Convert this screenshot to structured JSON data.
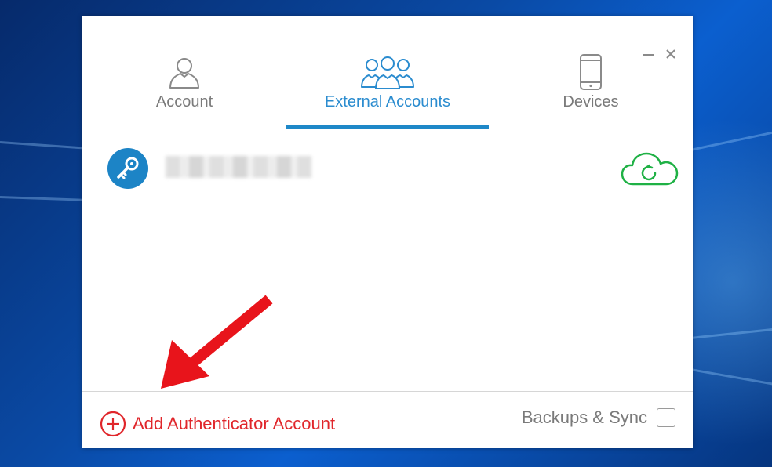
{
  "window": {
    "minimize_label": "—",
    "close_label": "✕"
  },
  "tabs": [
    {
      "label": "Account",
      "icon": "person-icon",
      "active": false
    },
    {
      "label": "External Accounts",
      "icon": "group-icon",
      "active": true
    },
    {
      "label": "Devices",
      "icon": "phone-icon",
      "active": false
    }
  ],
  "accounts": [
    {
      "icon": "key-icon",
      "status_icon": "cloud-sync-icon"
    }
  ],
  "footer": {
    "add_label": "Add Authenticator Account",
    "backup_label": "Backups & Sync"
  },
  "colors": {
    "accent": "#1e88c8",
    "add": "#e0262b",
    "sync": "#1fb145",
    "annotation_arrow": "#e8141b"
  }
}
